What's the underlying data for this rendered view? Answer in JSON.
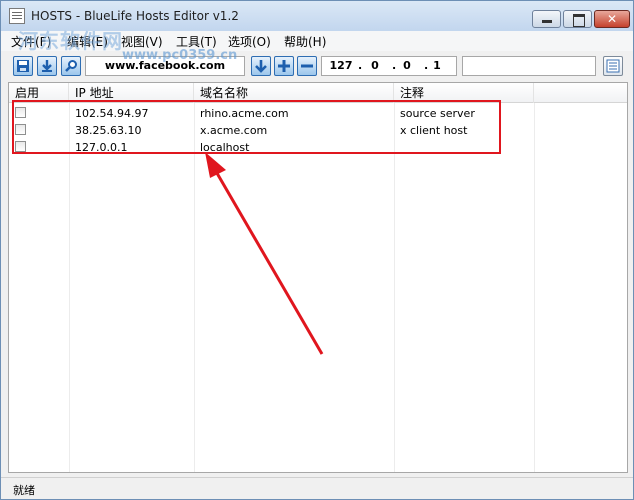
{
  "window": {
    "title": "HOSTS - BlueLife Hosts Editor v1.2"
  },
  "menu": [
    {
      "label": "文件(F)"
    },
    {
      "label": "编辑(E)"
    },
    {
      "label": "视图(V)"
    },
    {
      "label": "工具(T)"
    },
    {
      "label": "选项(O)"
    },
    {
      "label": "帮助(H)"
    }
  ],
  "toolbar": {
    "domain_value": "www.facebook.com",
    "ip_octets": [
      "127",
      "0",
      "0",
      "1"
    ]
  },
  "table": {
    "columns": [
      "启用",
      "IP 地址",
      "域名名称",
      "注释"
    ],
    "rows": [
      {
        "enabled": false,
        "ip": "102.54.94.97",
        "domain": "rhino.acme.com",
        "comment": "source server"
      },
      {
        "enabled": false,
        "ip": "38.25.63.10",
        "domain": "x.acme.com",
        "comment": "x client host"
      },
      {
        "enabled": false,
        "ip": "127.0.0.1",
        "domain": "localhost",
        "comment": ""
      }
    ]
  },
  "watermark": {
    "text": "河东软件网",
    "url": "www.pc0359.cn"
  },
  "status": {
    "text": "就绪"
  },
  "colors": {
    "annotation": "#e0161e",
    "toolbar_accent": "#2e6db2"
  }
}
